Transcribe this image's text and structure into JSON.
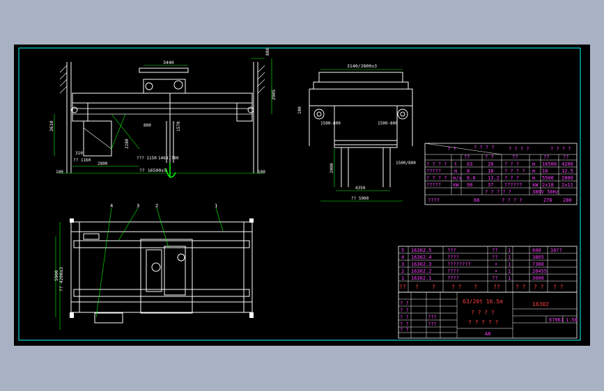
{
  "colors": {
    "background": "#a9b2c4",
    "sheet": "#000000",
    "frame": "#00ffff",
    "structure": "#ffffff",
    "dimension": "#00ff00",
    "table_text": "#ff40ff",
    "title_text": "#ff4040"
  },
  "front_view": {
    "dim_top_span": "3440",
    "dim_top_right": "880",
    "dim_right_height": "2905",
    "dim_left_height": "2610",
    "dim_bottom_total": "?? 16500±5",
    "dim_bottom_left": "2800",
    "dim_mid_a": "2280",
    "dim_mid_b": "??? 1150",
    "dim_mid_c": "1468",
    "dim_mid_d": "1780",
    "dim_mid_e": "?? 1160",
    "dim_left_a": "100",
    "dim_left_b": "310",
    "dim_right_a": "100",
    "dim_hook_a": "1570",
    "dim_hook_b": "800"
  },
  "side_view": {
    "dim_top": "3140/2800±3",
    "dim_left_small": "100",
    "dim_wheel_left": "1500-800",
    "dim_wheel_right": "1500-800",
    "dim_height": "2000",
    "dim_mid": "4350",
    "dim_bottom": "?? 5900",
    "dim_right_small": "1500/800"
  },
  "plan_view": {
    "labels": [
      "4",
      "3",
      "2",
      "1"
    ],
    "dim_left_total": "5900",
    "dim_left_inner": "?? 4200±3"
  },
  "spec_table": {
    "header": [
      "? ?",
      "? ? ? ?",
      "? ? ? ?",
      "? ? ? ?"
    ],
    "subheader": [
      "??",
      "? ?",
      "??",
      "??",
      "??"
    ],
    "rows": [
      [
        "? ? ? ?",
        "t",
        "63",
        "20",
        "? ? ?",
        "m",
        "16500",
        "4200"
      ],
      [
        "?????",
        "m",
        "8",
        "18",
        "? ? ? ?",
        "m",
        "10",
        "12.5"
      ],
      [
        "? ? ? ?",
        "m/s",
        "6.0",
        "13.2",
        "? ? ?",
        "m",
        "5500",
        "2800"
      ],
      [
        "?????",
        "kW",
        "90",
        "37",
        "??????",
        "kW",
        "2x18",
        "2x11"
      ]
    ],
    "power_row": [
      "? ? ? ? ?",
      "380V 50Hz"
    ],
    "last_row": [
      "????",
      "66",
      "? ? ? ?",
      "270",
      "280"
    ]
  },
  "parts_list": {
    "rows": [
      {
        "no": "5",
        "code": "16302.5",
        "name": "???",
        "qty": "??",
        "unit": "1",
        "mass": "600",
        "note": "10??"
      },
      {
        "no": "4",
        "code": "16302.4",
        "name": "????",
        "qty": "??",
        "unit": "1",
        "mass": "3865",
        "note": ""
      },
      {
        "no": "3",
        "code": "16302.3",
        "name": "????????",
        "qty": "•",
        "unit": "1",
        "mass": "7380",
        "note": ""
      },
      {
        "no": "2",
        "code": "16302.2",
        "name": "????",
        "qty": "•",
        "unit": "1",
        "mass": "20455",
        "note": ""
      },
      {
        "no": "1",
        "code": "16302.1",
        "name": "????",
        "qty": "??",
        "unit": "1",
        "mass": "3000",
        "note": ""
      }
    ],
    "header": [
      "??",
      "?",
      "?",
      "? ?",
      "?",
      "??",
      "? ?",
      "? ?",
      "? ?"
    ]
  },
  "title_block": {
    "product": "63/20t 16.5m",
    "name_line1": "? ? ? ?",
    "name_line2": "? ? ? ? ?",
    "drawing_no": "16302",
    "mass": "67961",
    "scale": "1:50",
    "sheet_size": "A6",
    "small_labels": [
      "? ?",
      "? ?",
      "???",
      "???",
      "? ?",
      "? ?",
      "? ?"
    ]
  }
}
